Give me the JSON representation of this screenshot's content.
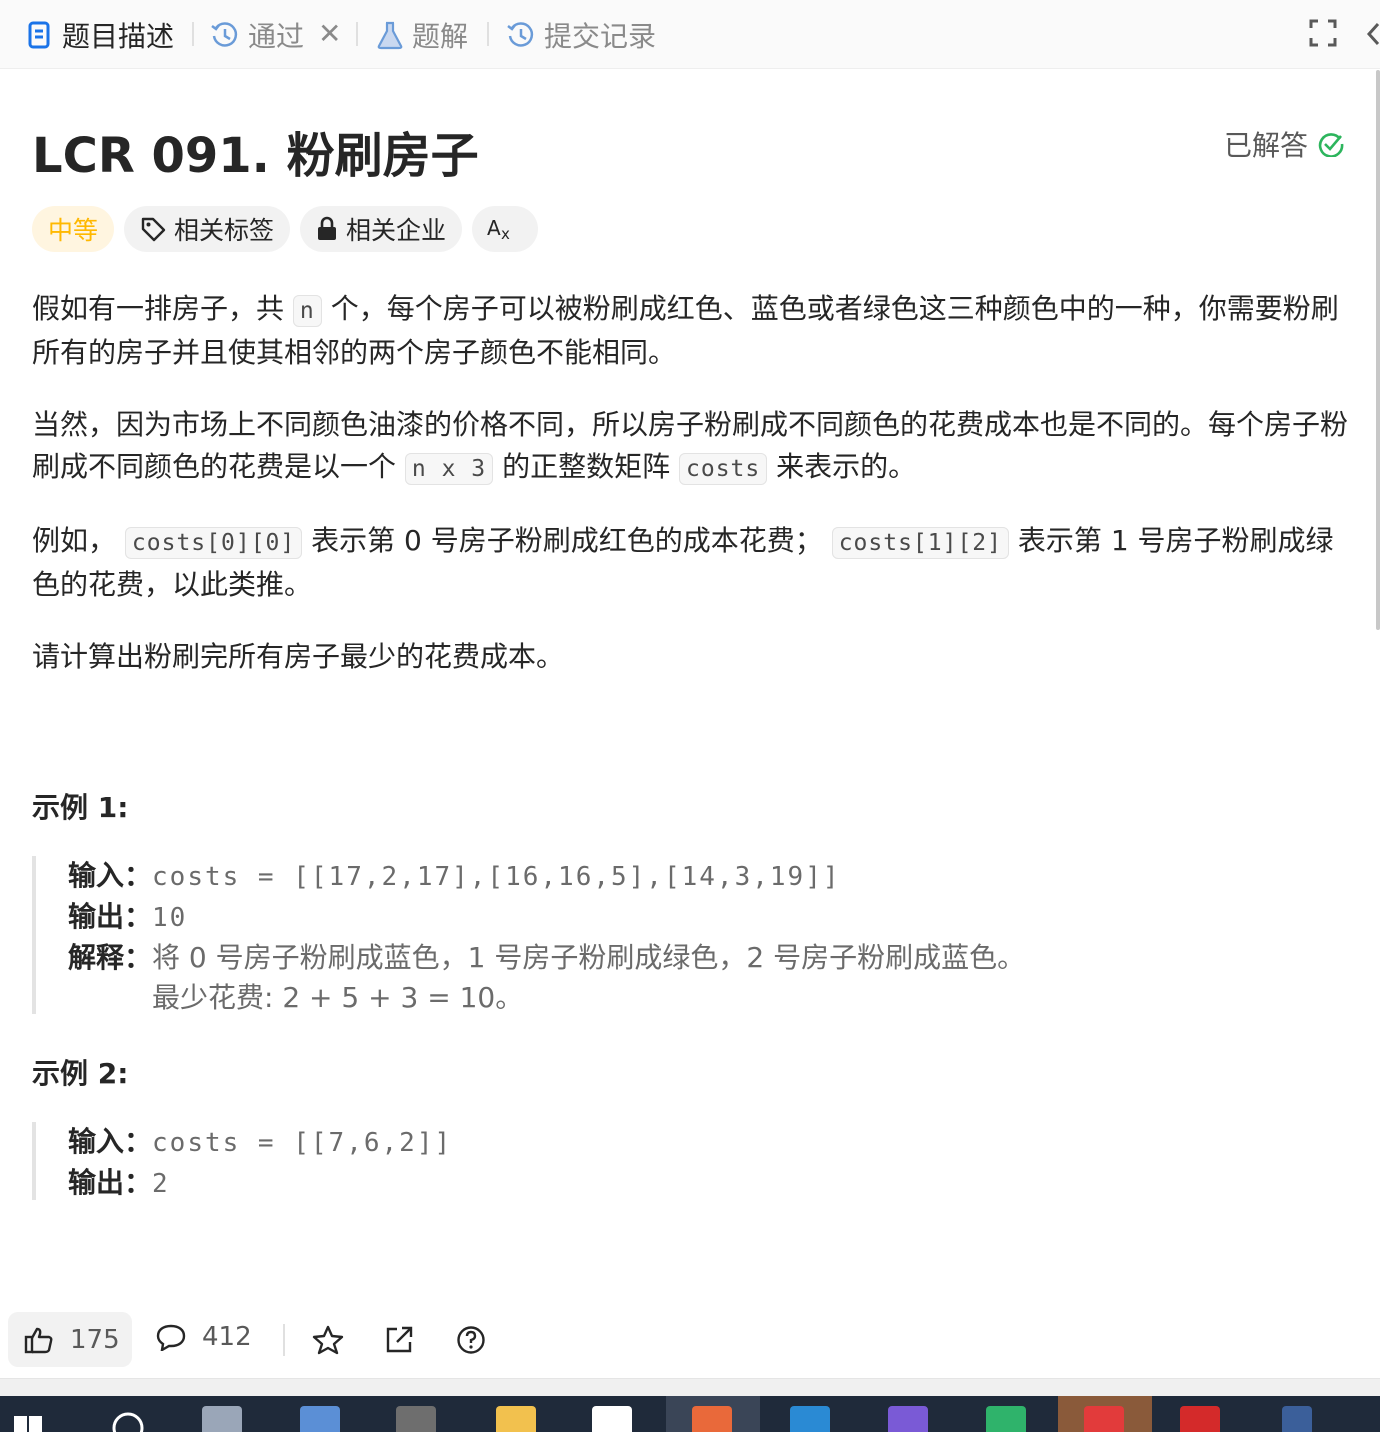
{
  "tabs": [
    {
      "label": "题目描述",
      "active": true
    },
    {
      "label": "通过",
      "active": false
    },
    {
      "label": "题解",
      "active": false
    },
    {
      "label": "提交记录",
      "active": false
    }
  ],
  "problem": {
    "title": "LCR 091. 粉刷房子",
    "status": "已解答",
    "difficulty": "中等",
    "tags_label": "相关标签",
    "companies_label": "相关企业"
  },
  "description": {
    "p1": {
      "a": "假如有一排房子，共",
      "code": "n",
      "b": "个，每个房子可以被粉刷成红色、蓝色或者绿色这三种颜色中的一种，你需要粉刷所有的房子并且使其相邻的两个房子颜色不能相同。"
    },
    "p2": {
      "a": "当然，因为市场上不同颜色油漆的价格不同，所以房子粉刷成不同颜色的花费成本也是不同的。每个房子粉刷成不同颜色的花费是以一个",
      "code1": "n x 3",
      "b": "的正整数矩阵",
      "code2": "costs",
      "c": "来表示的。"
    },
    "p3": {
      "a": "例如，",
      "code1": "costs[0][0]",
      "b": "表示第 0 号房子粉刷成红色的成本花费；",
      "code2": "costs[1][2]",
      "c": "表示第 1 号房子粉刷成绿色的花费，以此类推。"
    },
    "p4": "请计算出粉刷完所有房子最少的花费成本。"
  },
  "examples": [
    {
      "title": "示例 1:",
      "input_label": "输入：",
      "input": "costs = [[17,2,17],[16,16,5],[14,3,19]]",
      "output_label": "输出：",
      "output": "10",
      "explain_label": "解释：",
      "explain_line1": "将 0 号房子粉刷成蓝色，1 号房子粉刷成绿色，2 号房子粉刷成蓝色。",
      "explain_line2": "最少花费: 2 + 5 + 3 = 10。"
    },
    {
      "title": "示例 2:",
      "input_label": "输入：",
      "input": "costs = [[7,6,2]]",
      "output_label": "输出：",
      "output": "2"
    }
  ],
  "footer": {
    "likes": "175",
    "comments": "412"
  },
  "colors": {
    "accent_blue": "#1a73e8",
    "difficulty": "#ffb800",
    "solved_green": "#2db55d"
  },
  "icons": [
    "description-icon",
    "history-icon",
    "close-icon",
    "flask-icon",
    "fullscreen-icon",
    "tag-icon",
    "lock-icon",
    "translate-icon",
    "check-circle-icon",
    "thumbs-up-icon",
    "comment-icon",
    "star-icon",
    "share-icon",
    "help-icon"
  ]
}
